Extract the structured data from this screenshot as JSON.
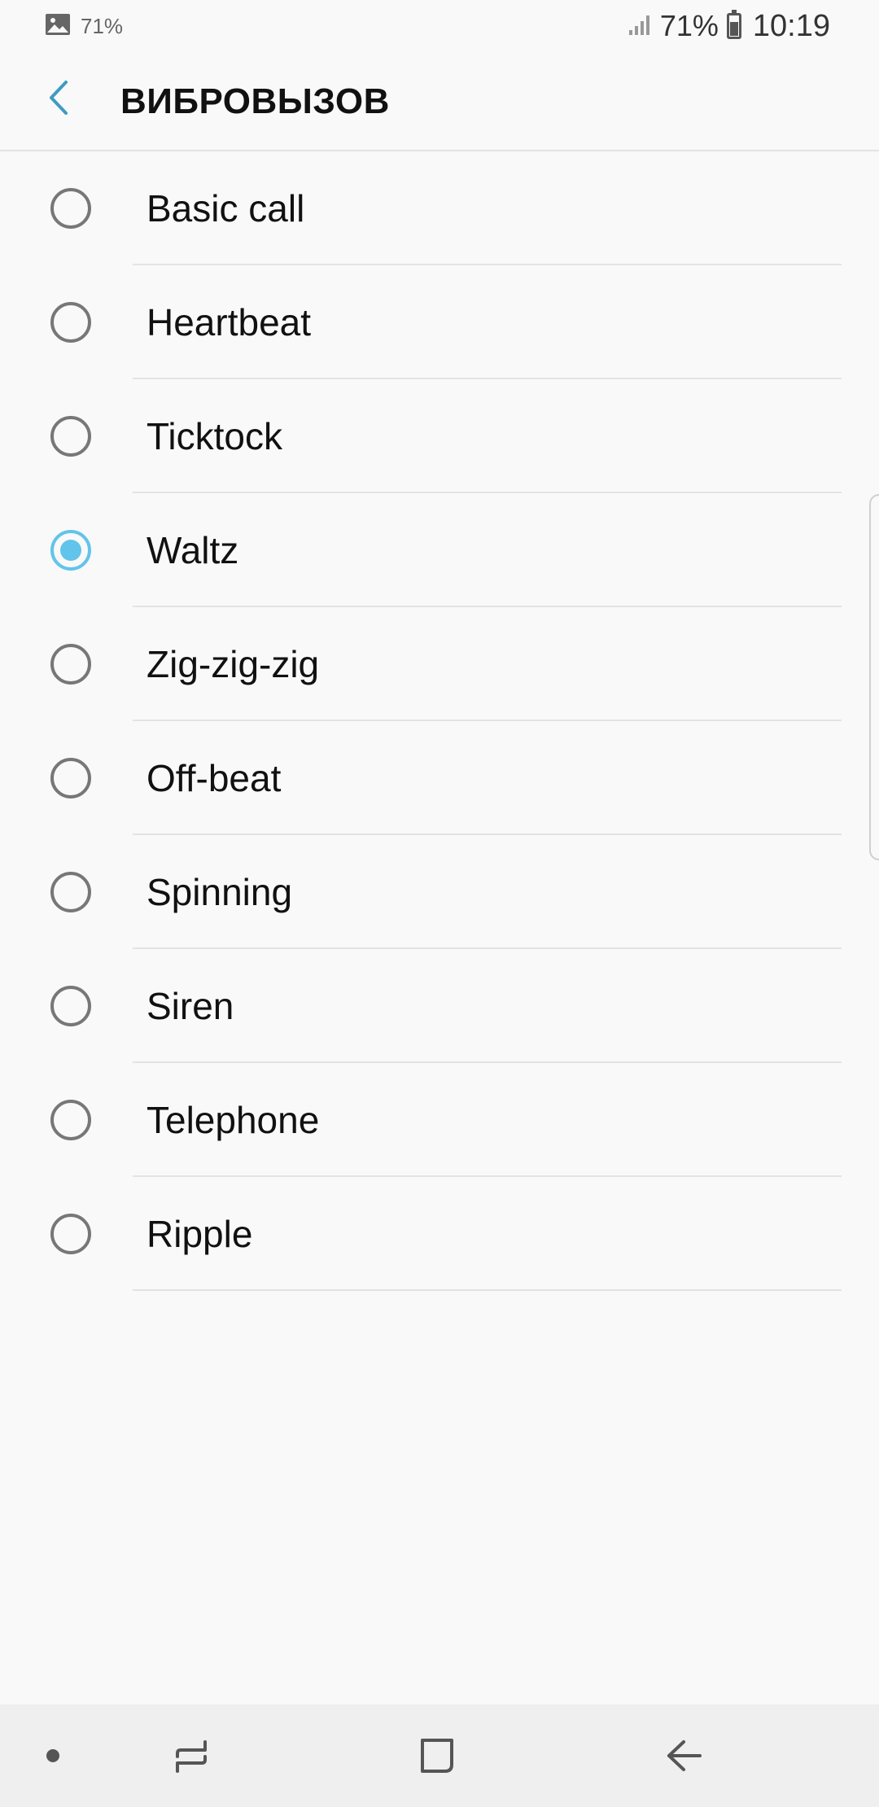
{
  "status_bar": {
    "notification_percent": "71%",
    "battery_percent": "71%",
    "time": "10:19",
    "icons": [
      "image-notification-icon",
      "signal-icon",
      "battery-icon"
    ],
    "battery_level": 0.71
  },
  "app_bar": {
    "title": "ВИБРОВЫЗОВ",
    "back_icon": "chevron-left-icon",
    "accent_color": "#3f9cc0"
  },
  "options": [
    {
      "label": "Basic call",
      "selected": false
    },
    {
      "label": "Heartbeat",
      "selected": false
    },
    {
      "label": "Ticktock",
      "selected": false
    },
    {
      "label": "Waltz",
      "selected": true
    },
    {
      "label": "Zig-zig-zig",
      "selected": false
    },
    {
      "label": "Off-beat",
      "selected": false
    },
    {
      "label": "Spinning",
      "selected": false
    },
    {
      "label": "Siren",
      "selected": false
    },
    {
      "label": "Telephone",
      "selected": false
    },
    {
      "label": "Ripple",
      "selected": false
    }
  ],
  "selected_color": "#62c4ea",
  "nav_bar": {
    "items": [
      "dot-indicator-icon",
      "recent-apps-icon",
      "home-icon",
      "back-arrow-icon"
    ]
  }
}
